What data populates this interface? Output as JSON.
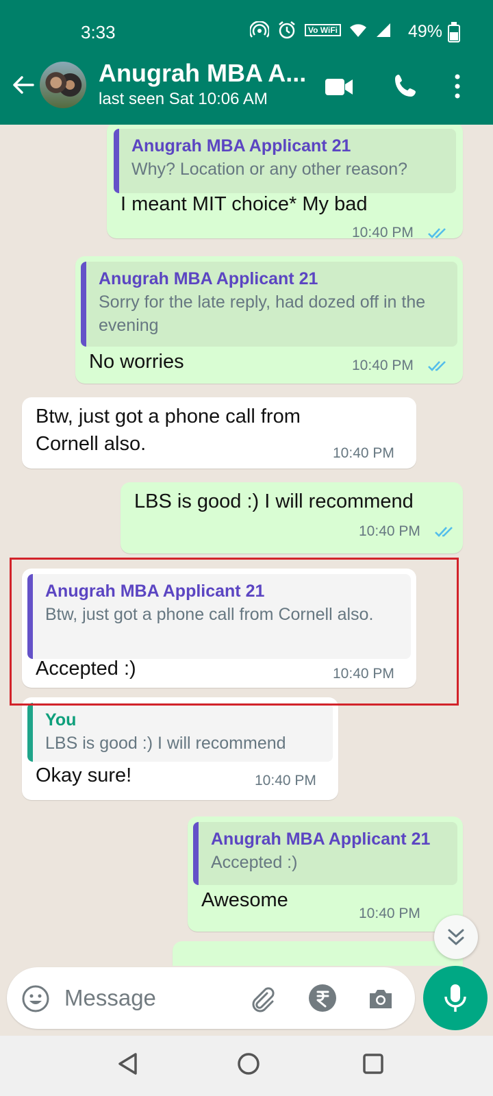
{
  "status_bar": {
    "time": "3:33",
    "battery": "49%",
    "vowifi": "Vo WiFi"
  },
  "header": {
    "contact_name": "Anugrah MBA A...",
    "last_seen": "last seen Sat 10:06 AM"
  },
  "messages": [
    {
      "direction": "outgoing",
      "quote_author": "Anugrah MBA Applicant 21",
      "quote_text": "Why? Location or any other reason?",
      "text": "I meant MIT choice* My bad",
      "time": "10:40 PM",
      "read": true
    },
    {
      "direction": "outgoing",
      "quote_author": "Anugrah MBA Applicant 21",
      "quote_text": "Sorry for the late reply, had dozed off in the evening",
      "text": "No worries",
      "time": "10:40 PM",
      "read": true
    },
    {
      "direction": "incoming",
      "text": "Btw, just got a phone call from Cornell also.",
      "time": "10:40 PM"
    },
    {
      "direction": "outgoing",
      "text": "LBS is good :) I will recommend",
      "time": "10:40 PM",
      "read": true
    },
    {
      "direction": "incoming",
      "quote_author": "Anugrah MBA Applicant 21",
      "quote_text": "Btw, just got a phone call from Cornell also.",
      "text": "Accepted :)",
      "time": "10:40 PM",
      "highlighted": true
    },
    {
      "direction": "incoming",
      "quote_author": "You",
      "quote_text": "LBS is good :) I will recommend",
      "text": "Okay sure!",
      "time": "10:40 PM"
    },
    {
      "direction": "outgoing",
      "quote_author": "Anugrah MBA Applicant 21",
      "quote_text": "Accepted :)",
      "text": "Awesome",
      "time": "10:40 PM",
      "read": true
    }
  ],
  "composer": {
    "placeholder": "Message"
  },
  "colors": {
    "header": "#008069",
    "outgoing_bubble": "#d9fdd3",
    "incoming_bubble": "#ffffff",
    "quote_author": "#5b45c2",
    "you_author": "#0e9f7b",
    "read_ticks": "#53bdeb",
    "highlight_border": "#d2232a",
    "mic_button": "#00a884"
  },
  "icons": [
    "back-arrow-icon",
    "video-call-icon",
    "phone-icon",
    "more-options-icon",
    "emoji-icon",
    "attach-icon",
    "rupee-icon",
    "camera-icon",
    "mic-icon",
    "scroll-down-icon",
    "double-tick-icon"
  ]
}
